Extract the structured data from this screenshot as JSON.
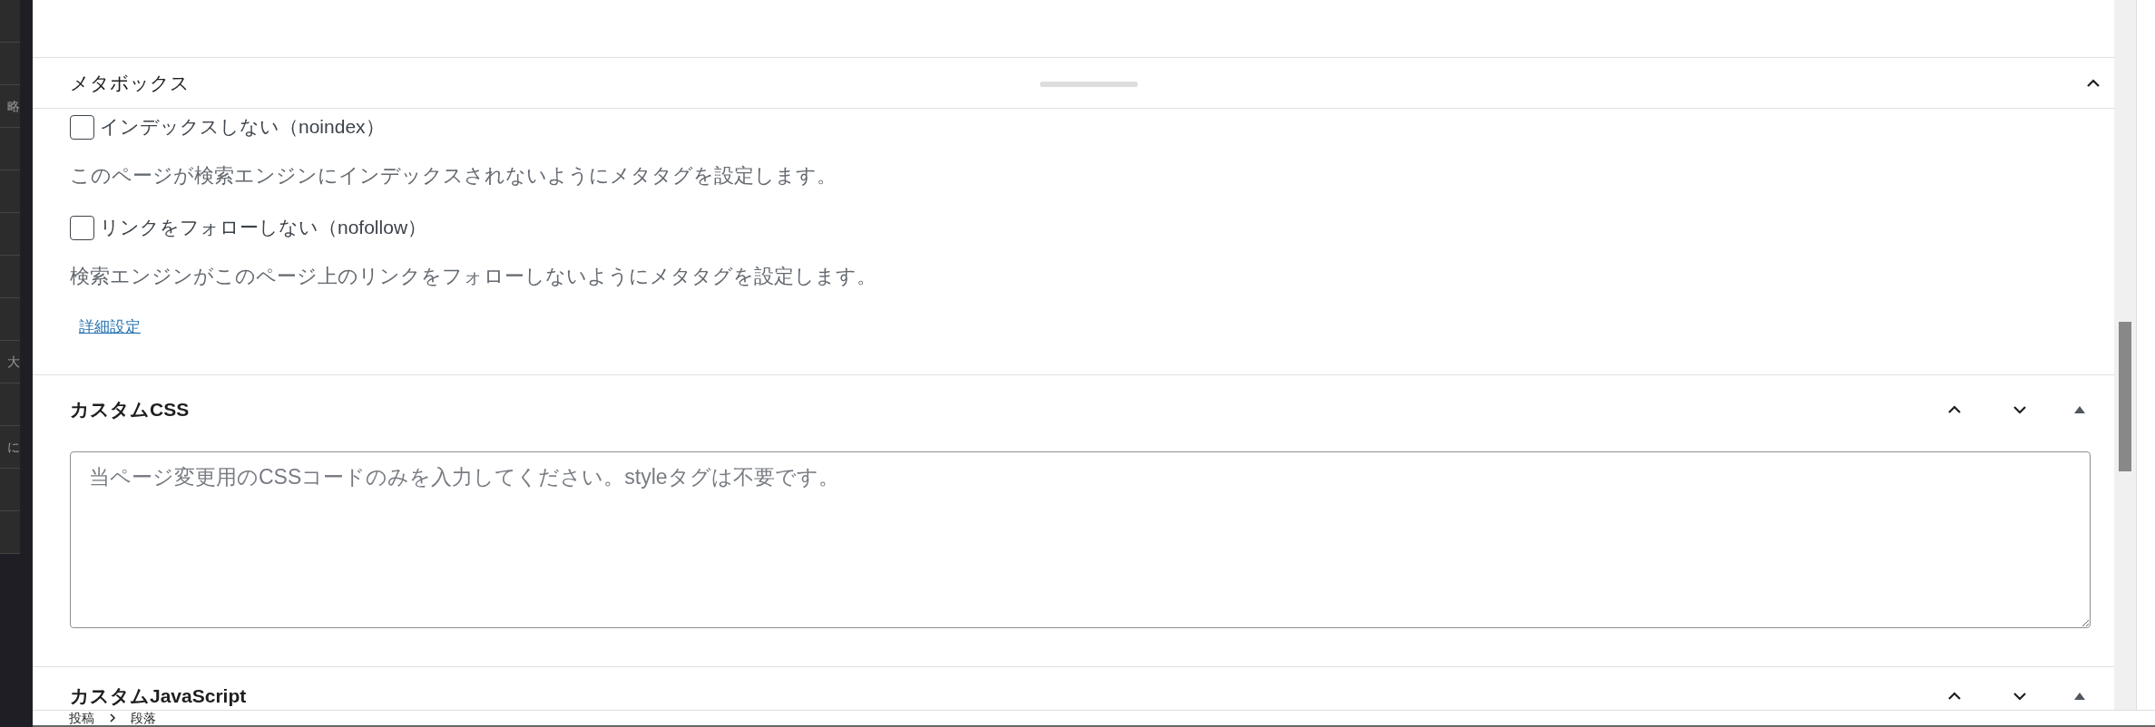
{
  "sidebar": {
    "items": [
      "略",
      "大",
      "に"
    ]
  },
  "metabox": {
    "title": "メタボックス",
    "expanded": true,
    "options": [
      {
        "label": "インデックスしない（noindex）",
        "checked": false,
        "description": "このページが検索エンジンにインデックスされないようにメタタグを設定します。"
      },
      {
        "label": "リンクをフォローしない（nofollow）",
        "checked": false,
        "description": "検索エンジンがこのページ上のリンクをフォローしないようにメタタグを設定します。"
      }
    ],
    "link": "詳細設定"
  },
  "panels": [
    {
      "title": "カスタムCSS",
      "placeholder": "当ページ変更用のCSSコードのみを入力してください。styleタグは不要です。"
    },
    {
      "title": "カスタムJavaScript"
    }
  ],
  "breadcrumb": [
    "投稿",
    "段落"
  ]
}
